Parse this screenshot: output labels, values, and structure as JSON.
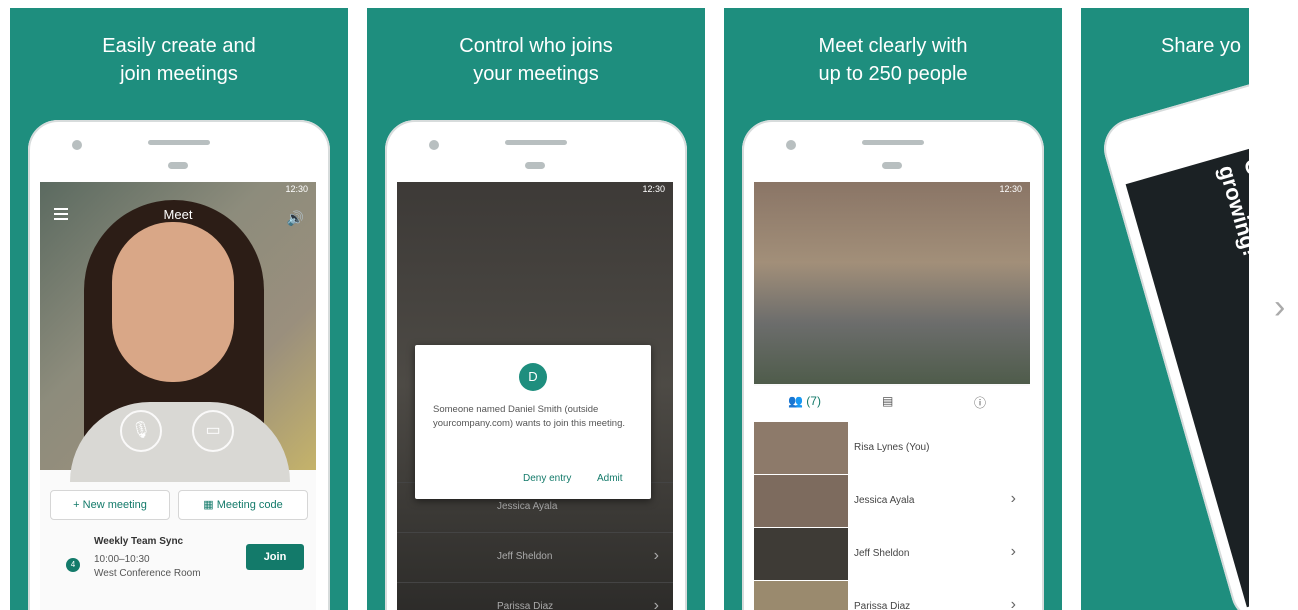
{
  "panels": [
    {
      "caption": [
        "Easily create and",
        "join meetings"
      ]
    },
    {
      "caption": [
        "Control who joins",
        "your meetings"
      ]
    },
    {
      "caption": [
        "Meet clearly with",
        "up to 250 people"
      ]
    },
    {
      "caption": [
        "Share yo",
        ""
      ]
    }
  ],
  "status_time": "12:30",
  "screen1": {
    "title": "Meet",
    "new_meeting": "New meeting",
    "meeting_code": "Meeting code",
    "event_title": "Weekly Team Sync",
    "event_time": "10:00–10:30",
    "event_room": "West Conference Room",
    "join": "Join"
  },
  "screen2": {
    "avatar_letter": "D",
    "dialog_text": "Someone named Daniel Smith (outside yourcompany.com) wants to join this meeting.",
    "deny": "Deny entry",
    "admit": "Admit",
    "rows": [
      "Jessica Ayala",
      "Jeff Sheldon",
      "Parissa Diaz"
    ]
  },
  "screen3": {
    "people_count": "(7)",
    "participants": [
      "Risa Lynes (You)",
      "Jessica Ayala",
      "Jeff Sheldon",
      "Parissa Diaz"
    ]
  },
  "screen4": {
    "text": [
      "Our team",
      "growing!"
    ]
  },
  "colors": {
    "brand_green": "#1e8e7e",
    "accent_dark": "#137a6a"
  },
  "icons": [
    "menu-icon",
    "volume-icon",
    "mic-icon",
    "camera-icon",
    "people-icon",
    "chat-icon",
    "info-icon",
    "chevron-right-icon"
  ]
}
